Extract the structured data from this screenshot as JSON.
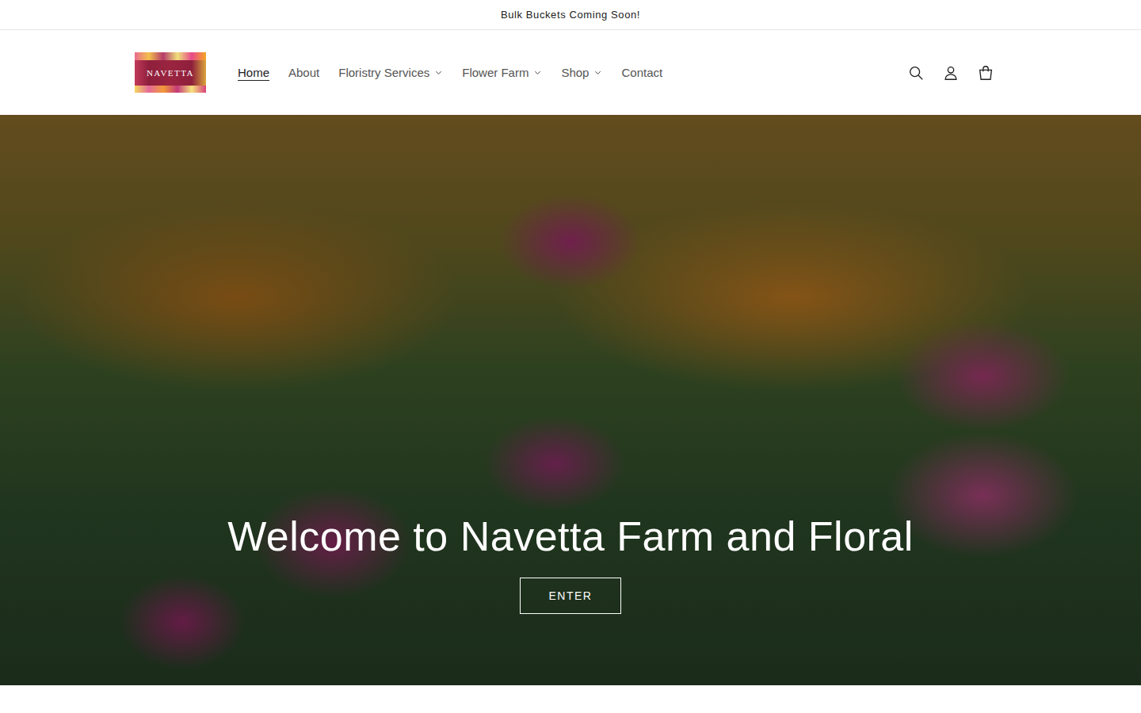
{
  "announcement": "Bulk Buckets Coming Soon!",
  "logo": {
    "text": "NAVETTA"
  },
  "nav": [
    {
      "label": "Home",
      "selected": true,
      "kind": "link"
    },
    {
      "label": "About",
      "selected": false,
      "kind": "link"
    },
    {
      "label": "Floristry Services",
      "selected": false,
      "kind": "menu"
    },
    {
      "label": "Flower Farm",
      "selected": false,
      "kind": "menu"
    },
    {
      "label": "Shop",
      "selected": false,
      "kind": "menu"
    },
    {
      "label": "Contact",
      "selected": false,
      "kind": "link"
    }
  ],
  "hero": {
    "title": "Welcome to Navetta Farm and Floral",
    "button": "ENTER"
  }
}
